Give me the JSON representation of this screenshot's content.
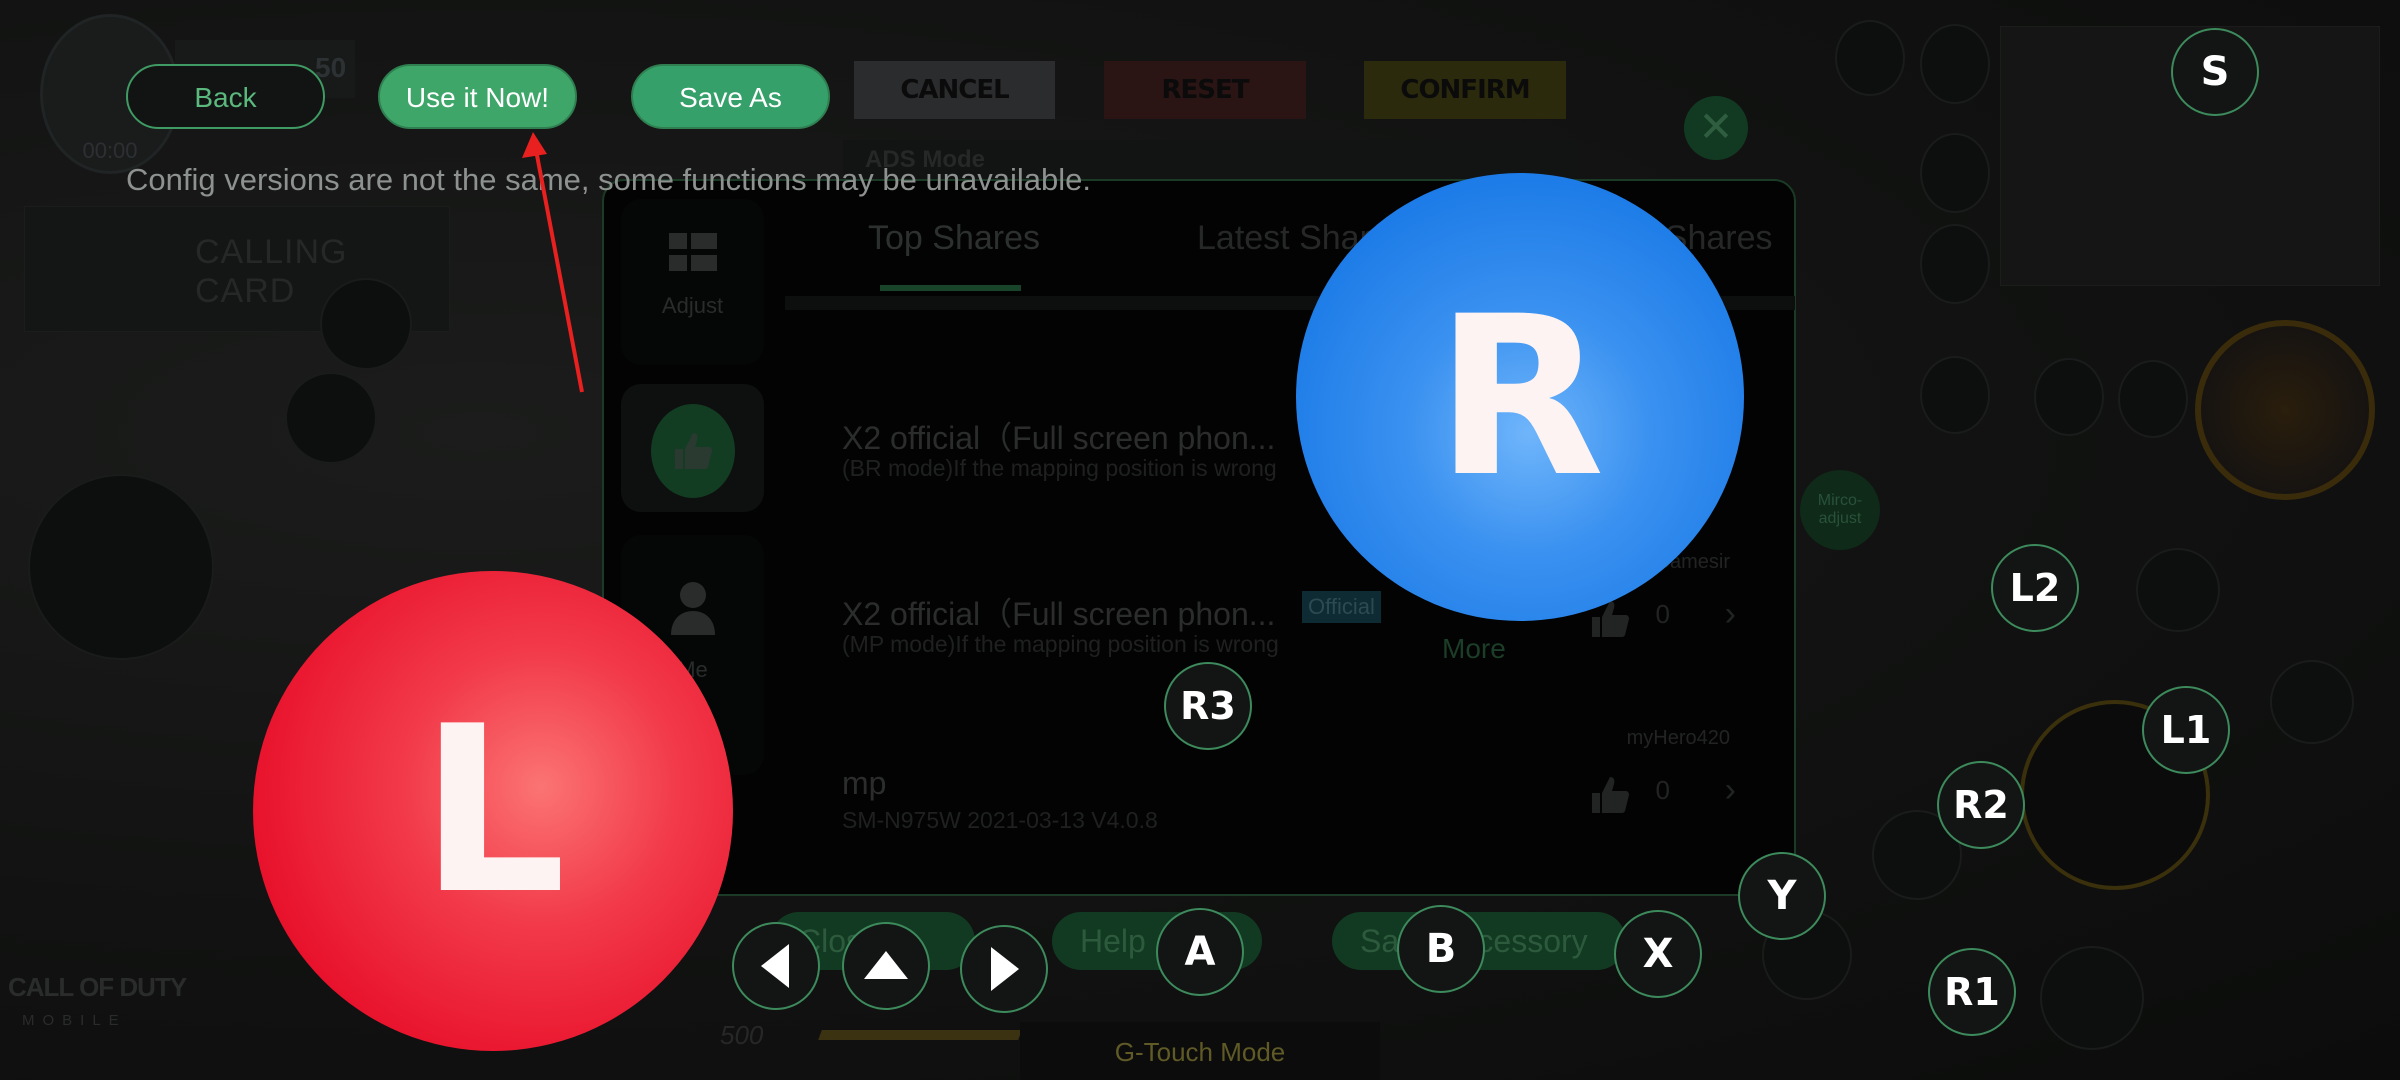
{
  "toolbar": {
    "back_label": "Back",
    "use_now_label": "Use it Now!",
    "save_as_label": "Save As"
  },
  "notice": "Config versions are not the same, some functions may be unavailable.",
  "background_game": {
    "timer": "00:00",
    "level": "50",
    "calling_card": "CALLING CARD",
    "top_buttons": [
      {
        "label": "CANCEL",
        "color": "#2a2c2e"
      },
      {
        "label": "RESET",
        "color": "#2a1414"
      },
      {
        "label": "CONFIRM",
        "color": "#2c2a0c"
      }
    ],
    "ads_mode": "ADS Mode",
    "micro_adjust": "Mirco-adjust",
    "hp": "500",
    "mode": "G-Touch Mode",
    "bottom_buttons": [
      "Close",
      "Help",
      "Save Accessory"
    ],
    "logo_top": "CALL OF DUTY",
    "logo_bottom": "MOBILE"
  },
  "modal": {
    "sidebar": [
      {
        "label": "Adjust",
        "icon": "grid-icon"
      },
      {
        "label": "",
        "icon": "thumbs-up-icon",
        "active": true
      },
      {
        "label": "Me",
        "icon": "person-icon"
      }
    ],
    "tabs": [
      {
        "label": "Top Shares",
        "active": true
      },
      {
        "label": "Latest Shares",
        "active": false
      },
      {
        "label": "My Shares",
        "active": false
      }
    ],
    "rows": [
      {
        "title": "X2 official（Full screen phon...",
        "subtitle": "(BR mode)If the mapping position is wrong",
        "badge": "",
        "owner": "",
        "likes": "",
        "more": ""
      },
      {
        "title": "X2 official（Full screen phon...",
        "subtitle": "(MP mode)If the mapping position is wrong",
        "badge": "Official",
        "owner": "Gamesir",
        "likes": "0",
        "more": "More"
      },
      {
        "title": "mp",
        "subtitle": "SM-N975W  2021-03-13 V4.0.8",
        "badge": "",
        "owner": "myHero420",
        "likes": "0",
        "more": ""
      }
    ]
  },
  "joysticks": {
    "left": {
      "label": "L",
      "color": "#e8112b"
    },
    "right": {
      "label": "R",
      "color": "#1878e6"
    }
  },
  "keys": {
    "S": "S",
    "R3": "R3",
    "A": "A",
    "B": "B",
    "X": "X",
    "Y": "Y",
    "L1": "L1",
    "L2": "L2",
    "R1": "R1",
    "R2": "R2"
  },
  "dpad": [
    "left-arrow",
    "up-arrow",
    "right-arrow"
  ],
  "colors": {
    "accent_green": "#3fa66a",
    "annotation_arrow": "#e8201f"
  }
}
